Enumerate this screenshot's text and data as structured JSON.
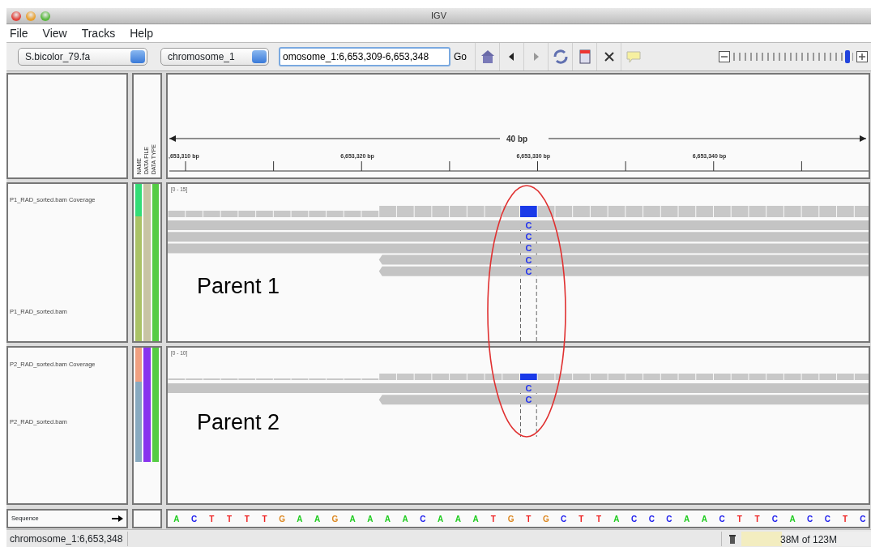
{
  "window": {
    "title": "IGV"
  },
  "menu": [
    "File",
    "View",
    "Tracks",
    "Help"
  ],
  "toolbar": {
    "genome": "S.bicolor_79.fa",
    "chromosome": "chromosome_1",
    "locus": "omosome_1:6,653,309-6,653,348",
    "go": "Go",
    "zoom": {
      "level": 0.97
    }
  },
  "header": {
    "attributes": [
      "NAME",
      "DATA FILE",
      "DATA TYPE"
    ],
    "ruler": {
      "span": "40 bp",
      "labels": [
        ",653,310 bp",
        "6,653,320 bp",
        "6,653,330 bp",
        "6,653,340 bp"
      ]
    }
  },
  "panels": [
    {
      "label": "Parent 1",
      "range": "[0 - 15]",
      "tracks": [
        {
          "kind": "coverage",
          "name": "P1_RAD_sorted.bam Coverage",
          "attributes": [
            {
              "color": "#33dd77"
            },
            {
              "color": "#c8c4a4"
            },
            {
              "color": "#55cc44"
            }
          ]
        },
        {
          "kind": "reads",
          "name": "P1_RAD_sorted.bam",
          "attributes": [
            {
              "color": "#aac266"
            },
            {
              "color": "#c8c4a4"
            },
            {
              "color": "#55cc44"
            }
          ]
        }
      ],
      "reads": [
        {
          "kind": "full",
          "mismatch": "C"
        },
        {
          "kind": "full",
          "mismatch": "C"
        },
        {
          "kind": "full",
          "mismatch": "C"
        },
        {
          "kind": "clipped",
          "mismatch": "C"
        },
        {
          "kind": "clipped",
          "mismatch": "C"
        }
      ]
    },
    {
      "label": "Parent 2",
      "range": "[0 - 10]",
      "tracks": [
        {
          "kind": "coverage",
          "name": "P2_RAD_sorted.bam Coverage",
          "attributes": [
            {
              "color": "#f0a080"
            },
            {
              "color": "#8833ee"
            },
            {
              "color": "#55cc44"
            }
          ]
        },
        {
          "kind": "reads",
          "name": "P2_RAD_sorted.bam",
          "attributes": [
            {
              "color": "#88aac0"
            },
            {
              "color": "#8833ee"
            },
            {
              "color": "#55cc44"
            }
          ]
        }
      ],
      "reads": [
        {
          "kind": "full",
          "mismatch": "C"
        },
        {
          "kind": "clipped",
          "mismatch": "C"
        }
      ]
    }
  ],
  "sequence": {
    "name": "Sequence",
    "bases": [
      {
        "base": "A",
        "color": "#22cc22"
      },
      {
        "base": "C",
        "color": "#2222ee"
      },
      {
        "base": "T",
        "color": "#ee2222"
      },
      {
        "base": "T",
        "color": "#ee2222"
      },
      {
        "base": "T",
        "color": "#ee2222"
      },
      {
        "base": "T",
        "color": "#ee2222"
      },
      {
        "base": "G",
        "color": "#dd8822"
      },
      {
        "base": "A",
        "color": "#22cc22"
      },
      {
        "base": "A",
        "color": "#22cc22"
      },
      {
        "base": "G",
        "color": "#dd8822"
      },
      {
        "base": "A",
        "color": "#22cc22"
      },
      {
        "base": "A",
        "color": "#22cc22"
      },
      {
        "base": "A",
        "color": "#22cc22"
      },
      {
        "base": "A",
        "color": "#22cc22"
      },
      {
        "base": "C",
        "color": "#2222ee"
      },
      {
        "base": "A",
        "color": "#22cc22"
      },
      {
        "base": "A",
        "color": "#22cc22"
      },
      {
        "base": "A",
        "color": "#22cc22"
      },
      {
        "base": "T",
        "color": "#ee2222"
      },
      {
        "base": "G",
        "color": "#dd8822"
      },
      {
        "base": "T",
        "color": "#ee2222"
      },
      {
        "base": "G",
        "color": "#dd8822"
      },
      {
        "base": "C",
        "color": "#2222ee"
      },
      {
        "base": "T",
        "color": "#ee2222"
      },
      {
        "base": "T",
        "color": "#ee2222"
      },
      {
        "base": "A",
        "color": "#22cc22"
      },
      {
        "base": "C",
        "color": "#2222ee"
      },
      {
        "base": "C",
        "color": "#2222ee"
      },
      {
        "base": "C",
        "color": "#2222ee"
      },
      {
        "base": "A",
        "color": "#22cc22"
      },
      {
        "base": "A",
        "color": "#22cc22"
      },
      {
        "base": "C",
        "color": "#2222ee"
      },
      {
        "base": "T",
        "color": "#ee2222"
      },
      {
        "base": "T",
        "color": "#ee2222"
      },
      {
        "base": "C",
        "color": "#2222ee"
      },
      {
        "base": "A",
        "color": "#22cc22"
      },
      {
        "base": "C",
        "color": "#2222ee"
      },
      {
        "base": "C",
        "color": "#2222ee"
      },
      {
        "base": "T",
        "color": "#ee2222"
      },
      {
        "base": "C",
        "color": "#2222ee"
      }
    ]
  },
  "status_bar": {
    "locus": "chromosome_1:6,653,348",
    "memory": {
      "text": "38M of 123M",
      "level": 0.31
    }
  }
}
